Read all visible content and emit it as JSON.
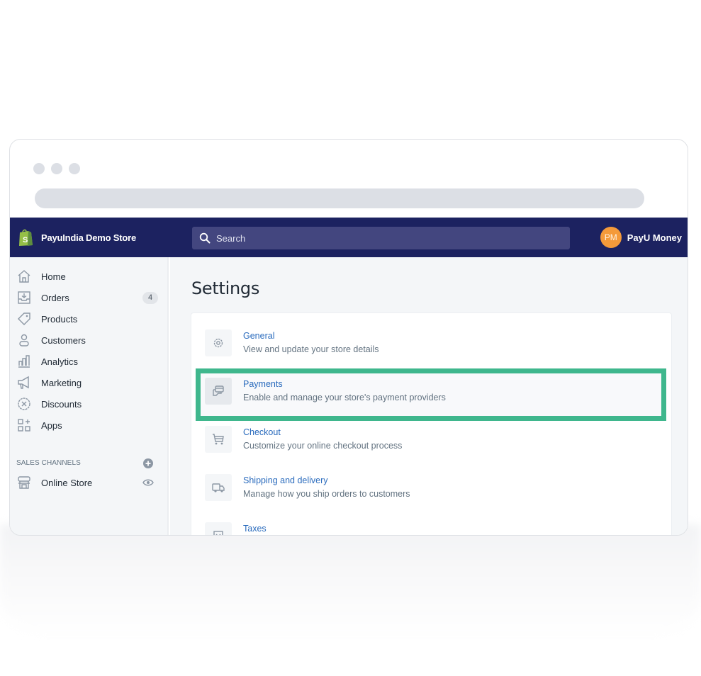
{
  "browser": {
    "window_dots": 3
  },
  "topbar": {
    "store_name": "PayuIndia Demo Store",
    "search_placeholder": "Search",
    "user_initials": "PM",
    "user_name": "PayU Money"
  },
  "sidebar": {
    "items": [
      {
        "label": "Home",
        "icon": "home-icon"
      },
      {
        "label": "Orders",
        "icon": "orders-icon",
        "badge": "4"
      },
      {
        "label": "Products",
        "icon": "tag-icon"
      },
      {
        "label": "Customers",
        "icon": "customer-icon"
      },
      {
        "label": "Analytics",
        "icon": "analytics-icon"
      },
      {
        "label": "Marketing",
        "icon": "megaphone-icon"
      },
      {
        "label": "Discounts",
        "icon": "discount-icon"
      },
      {
        "label": "Apps",
        "icon": "apps-icon"
      }
    ],
    "sales_channels_label": "SALES CHANNELS",
    "channels": [
      {
        "label": "Online Store",
        "icon": "store-icon"
      }
    ]
  },
  "main": {
    "title": "Settings",
    "settings": [
      {
        "title": "General",
        "description": "View and update your store details",
        "icon": "gear-icon"
      },
      {
        "title": "Payments",
        "description": "Enable and manage your store's payment providers",
        "icon": "payments-icon",
        "highlighted": true
      },
      {
        "title": "Checkout",
        "description": "Customize your online checkout process",
        "icon": "cart-icon"
      },
      {
        "title": "Shipping and delivery",
        "description": "Manage how you ship orders to customers",
        "icon": "truck-icon"
      },
      {
        "title": "Taxes",
        "description": "",
        "icon": "taxes-icon"
      }
    ]
  },
  "colors": {
    "topbar_bg": "#1c2260",
    "highlight_border": "#3fb78d",
    "link": "#2a6bbd",
    "avatar_bg": "#f49a3a"
  }
}
